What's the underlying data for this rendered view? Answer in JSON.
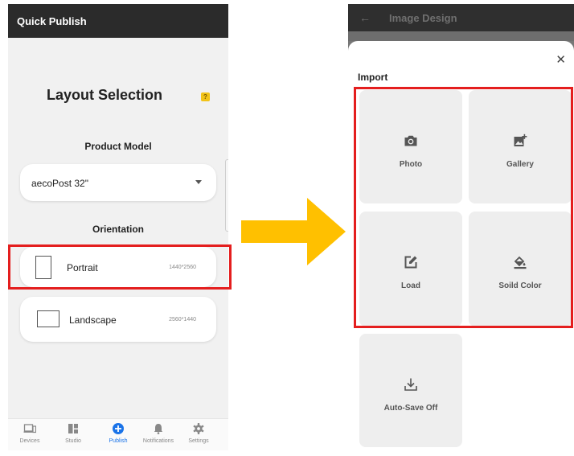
{
  "left": {
    "app_title": "Quick Publish",
    "layout_title": "Layout Selection",
    "help_icon": "help-icon",
    "product_model_label": "Product Model",
    "product_model_value": "aecoPost 32\"",
    "orientation_label": "Orientation",
    "orientations": [
      {
        "name": "Portrait",
        "resolution": "1440*2560",
        "highlighted": true
      },
      {
        "name": "Landscape",
        "resolution": "2560*1440",
        "highlighted": false
      }
    ],
    "nav": [
      {
        "label": "Devices",
        "icon": "devices-icon",
        "active": false
      },
      {
        "label": "Studio",
        "icon": "studio-icon",
        "active": false
      },
      {
        "label": "Publish",
        "icon": "publish-plus-icon",
        "active": true
      },
      {
        "label": "Notifications",
        "icon": "bell-icon",
        "active": false
      },
      {
        "label": "Settings",
        "icon": "gear-icon",
        "active": false
      }
    ]
  },
  "right": {
    "app_title": "Image Design",
    "sheet_title": "Import",
    "tiles": [
      {
        "label": "Photo",
        "icon": "camera-icon"
      },
      {
        "label": "Gallery",
        "icon": "add-image-icon"
      },
      {
        "label": "Load",
        "icon": "edit-icon"
      },
      {
        "label": "Soild Color",
        "icon": "paint-bucket-icon"
      },
      {
        "label": "Auto-Save Off",
        "icon": "download-icon"
      }
    ]
  },
  "colors": {
    "highlight": "#e41e1e",
    "arrow": "#ffc000",
    "active_nav": "#1a73e8",
    "help_badge": "#f2c318"
  }
}
